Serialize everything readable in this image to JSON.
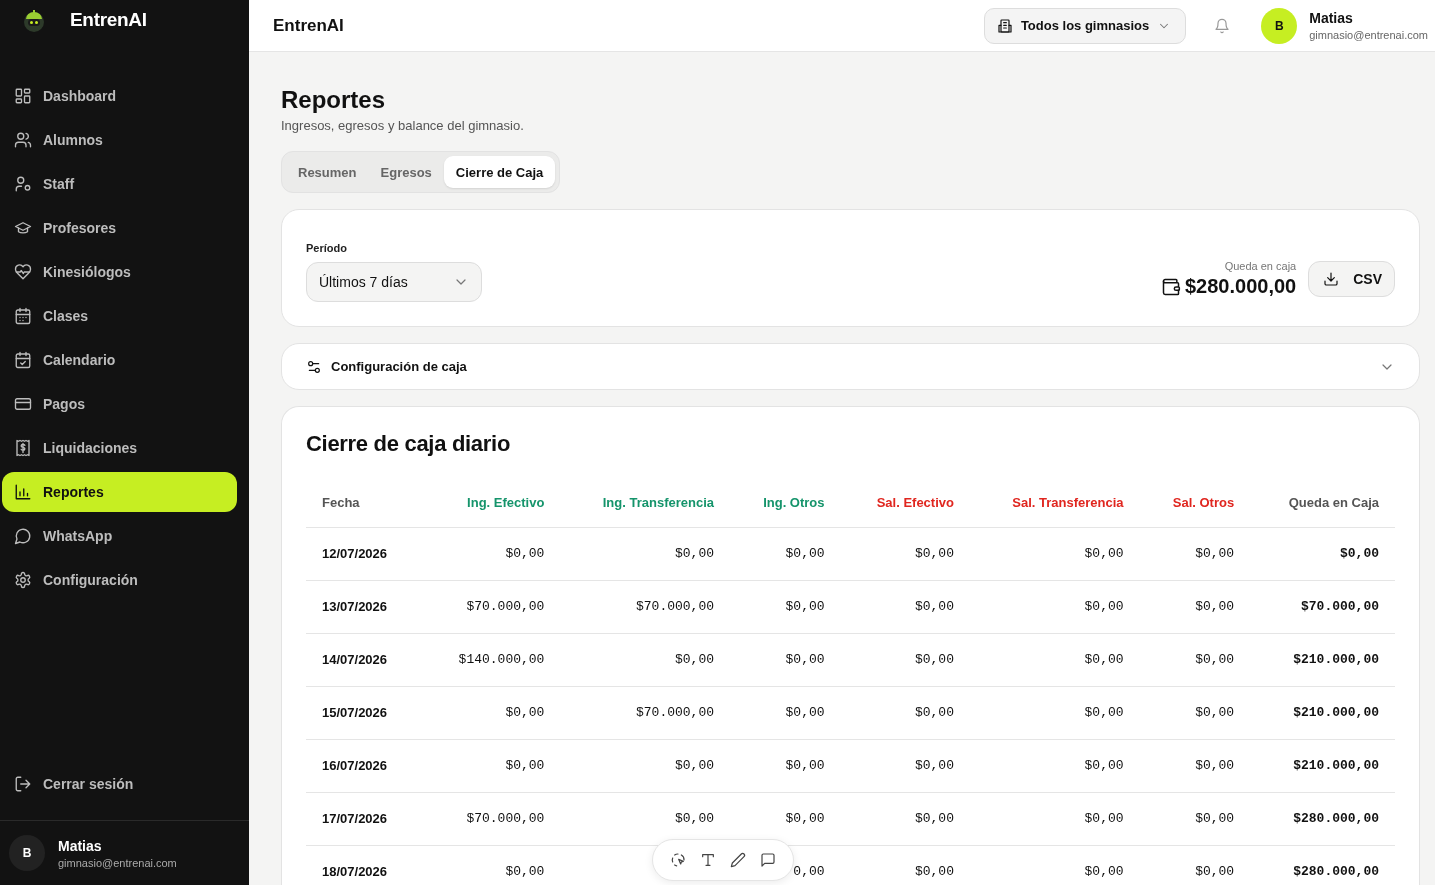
{
  "sidebar": {
    "brand": "EntrenAI",
    "items": [
      {
        "label": "Dashboard",
        "selected": false
      },
      {
        "label": "Alumnos",
        "selected": false
      },
      {
        "label": "Staff",
        "selected": false
      },
      {
        "label": "Profesores",
        "selected": false
      },
      {
        "label": "Kinesiólogos",
        "selected": false
      },
      {
        "label": "Clases",
        "selected": false
      },
      {
        "label": "Calendario",
        "selected": false
      },
      {
        "label": "Pagos",
        "selected": false
      },
      {
        "label": "Liquidaciones",
        "selected": false
      },
      {
        "label": "Reportes",
        "selected": true
      },
      {
        "label": "WhatsApp",
        "selected": false
      },
      {
        "label": "Configuración",
        "selected": false
      }
    ],
    "logout": "Cerrar sesión",
    "user": {
      "initial": "B",
      "name": "Matias",
      "email": "gimnasio@entrenai.com"
    }
  },
  "topbar": {
    "title": "EntrenAI",
    "gym_selector": "Todos los gimnasios",
    "user": {
      "initial": "B",
      "name": "Matias",
      "email": "gimnasio@entrenai.com"
    }
  },
  "page": {
    "title": "Reportes",
    "subtitle": "Ingresos, egresos y balance del gimnasio."
  },
  "tabs": [
    {
      "label": "Resumen",
      "selected": false
    },
    {
      "label": "Egresos",
      "selected": false
    },
    {
      "label": "Cierre de Caja",
      "selected": true
    }
  ],
  "filter": {
    "label": "Período",
    "value": "Últimos 7 días",
    "balance_label": "Queda en caja",
    "balance": "$280.000,00",
    "export_button": "CSV"
  },
  "config_panel": {
    "label": "Configuración de caja",
    "expanded": false
  },
  "table": {
    "title": "Cierre de caja diario",
    "columns": [
      {
        "label": "Fecha",
        "kind": "date"
      },
      {
        "label": "Ing. Efectivo",
        "kind": "income"
      },
      {
        "label": "Ing. Transferencia",
        "kind": "income"
      },
      {
        "label": "Ing. Otros",
        "kind": "income"
      },
      {
        "label": "Sal. Efectivo",
        "kind": "expense"
      },
      {
        "label": "Sal. Transferencia",
        "kind": "expense"
      },
      {
        "label": "Sal. Otros",
        "kind": "expense"
      },
      {
        "label": "Queda en Caja",
        "kind": "total"
      }
    ],
    "rows": [
      [
        "12/07/2026",
        "$0,00",
        "$0,00",
        "$0,00",
        "$0,00",
        "$0,00",
        "$0,00",
        "$0,00"
      ],
      [
        "13/07/2026",
        "$70.000,00",
        "$70.000,00",
        "$0,00",
        "$0,00",
        "$0,00",
        "$0,00",
        "$70.000,00"
      ],
      [
        "14/07/2026",
        "$140.000,00",
        "$0,00",
        "$0,00",
        "$0,00",
        "$0,00",
        "$0,00",
        "$210.000,00"
      ],
      [
        "15/07/2026",
        "$0,00",
        "$70.000,00",
        "$0,00",
        "$0,00",
        "$0,00",
        "$0,00",
        "$210.000,00"
      ],
      [
        "16/07/2026",
        "$0,00",
        "$0,00",
        "$0,00",
        "$0,00",
        "$0,00",
        "$0,00",
        "$210.000,00"
      ],
      [
        "17/07/2026",
        "$70.000,00",
        "$0,00",
        "$0,00",
        "$0,00",
        "$0,00",
        "$0,00",
        "$280.000,00"
      ],
      [
        "18/07/2026",
        "$0,00",
        null,
        "0,00",
        "$0,00",
        "$0,00",
        "$0,00",
        "$280.000,00"
      ]
    ]
  }
}
